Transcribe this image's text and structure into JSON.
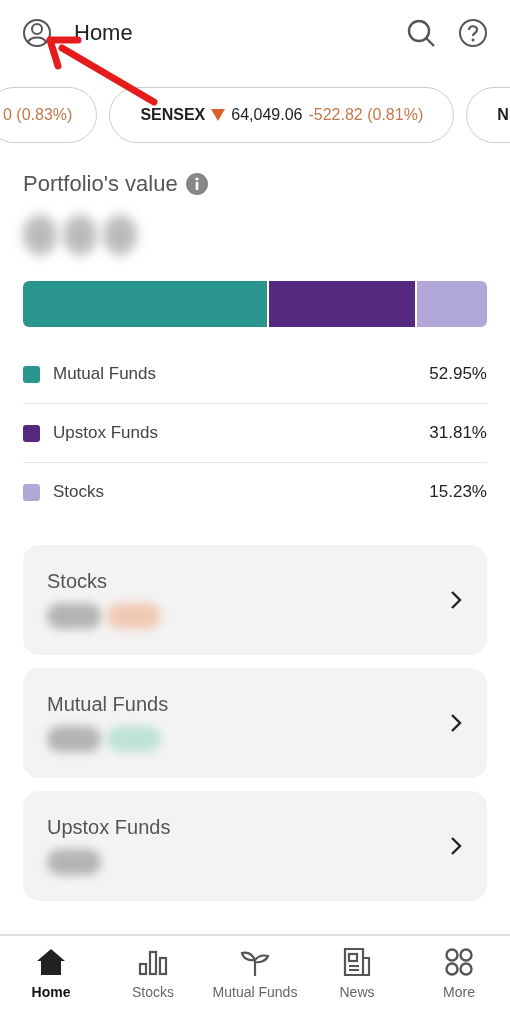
{
  "header": {
    "title": "Home"
  },
  "tickers": [
    {
      "change": "0 (0.83%)",
      "falling": true
    },
    {
      "name": "SENSEX",
      "value": "64,049.06",
      "change": "-522.82 (0.81%)",
      "falling": true
    },
    {
      "name": "N"
    }
  ],
  "portfolio": {
    "title": "Portfolio's value",
    "allocation": [
      {
        "label": "Mutual Funds",
        "percent": "52.95%",
        "color": "#2a968f"
      },
      {
        "label": "Upstox Funds",
        "percent": "31.81%",
        "color": "#56287f"
      },
      {
        "label": "Stocks",
        "percent": "15.23%",
        "color": "#b1a8d9"
      }
    ]
  },
  "cards": [
    {
      "title": "Stocks"
    },
    {
      "title": "Mutual Funds"
    },
    {
      "title": "Upstox Funds"
    }
  ],
  "nav": [
    {
      "label": "Home",
      "kind": "home",
      "selected": true
    },
    {
      "label": "Stocks",
      "kind": "stocks",
      "selected": false
    },
    {
      "label": "Mutual Funds",
      "kind": "plant",
      "selected": false
    },
    {
      "label": "News",
      "kind": "news",
      "selected": false
    },
    {
      "label": "More",
      "kind": "more",
      "selected": false
    }
  ]
}
